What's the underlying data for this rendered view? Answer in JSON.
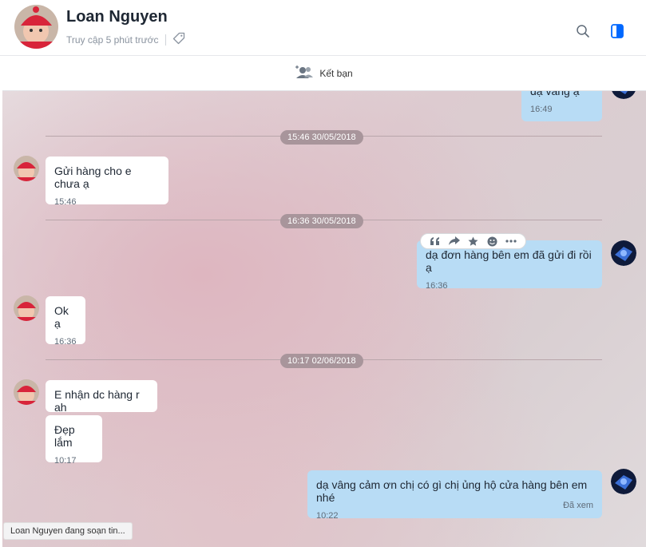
{
  "header": {
    "name": "Loan Nguyen",
    "status": "Truy cập 5 phút trước"
  },
  "add_friend": {
    "label": "Kết bạn"
  },
  "messages": [
    {
      "id": "m0",
      "direction": "out",
      "text": "dạ vâng ạ",
      "time": "16:49"
    },
    {
      "id": "d1",
      "type": "date",
      "text": "15:46 30/05/2018"
    },
    {
      "id": "m1",
      "direction": "in",
      "text": "Gửi hàng cho e chưa ạ",
      "time": "15:46"
    },
    {
      "id": "d2",
      "type": "date",
      "text": "16:36 30/05/2018"
    },
    {
      "id": "m2",
      "direction": "out",
      "text": "dạ đơn hàng bên em đã gửi đi rồi ạ",
      "time": "16:36"
    },
    {
      "id": "m3",
      "direction": "in",
      "text": "Ok ạ",
      "time": "16:36"
    },
    {
      "id": "d3",
      "type": "date",
      "text": "10:17 02/06/2018"
    },
    {
      "id": "m4",
      "direction": "in",
      "text": "E nhận dc hàng r ah"
    },
    {
      "id": "m5",
      "direction": "in",
      "text": "Đẹp lắm",
      "time": "10:17"
    },
    {
      "id": "m6",
      "direction": "out",
      "text": "dạ vâng cảm ơn chị có gì chị ủng hộ cửa hàng bên em nhé",
      "time": "10:22",
      "status": "Đã xem"
    }
  ],
  "typing": "Loan Nguyen đang soạn tin...",
  "colors": {
    "accent": "#0068ff",
    "outgoing_bubble": "#b8dcf5",
    "incoming_bubble": "#ffffff"
  },
  "icons": {
    "search": "search-icon",
    "panel": "panel-toggle-icon",
    "tag": "tag-icon",
    "add_friend": "add-friend-icon"
  }
}
